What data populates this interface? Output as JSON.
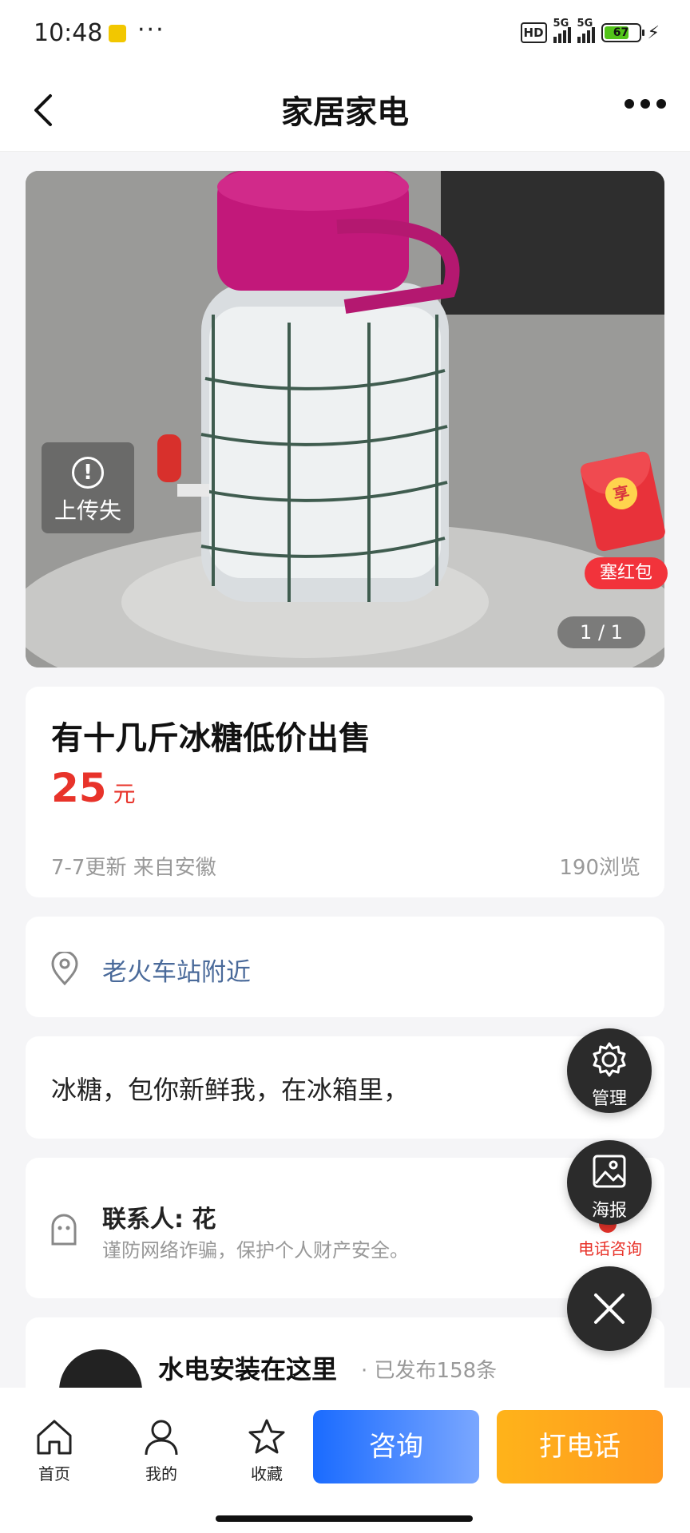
{
  "status": {
    "time": "10:48",
    "dots": "···",
    "hd": "HD",
    "net1": "5G",
    "net2": "5G",
    "battery": "67"
  },
  "header": {
    "title": "家居家电"
  },
  "photo": {
    "upload_status": "上传失",
    "counter": "1 / 1",
    "redpacket_coin": "享",
    "redpacket_label": "塞红包"
  },
  "listing": {
    "title": "有十几斤冰糖低价出售",
    "price": "25",
    "price_unit": "元",
    "updated": "7-7更新 来自安徽",
    "views": "190浏览"
  },
  "location": {
    "text": "老火车站附近"
  },
  "description": {
    "text": "冰糖，包你新鲜我，在冰箱里，"
  },
  "contact": {
    "name": "联系人: 花",
    "warning": "谨防网络诈骗，保护个人财产安全。",
    "phone_consult": "电话咨询"
  },
  "author": {
    "name": "水电安装在这里",
    "count": "· 已发布158条"
  },
  "fabs": {
    "manage": "管理",
    "poster": "海报"
  },
  "bottom": {
    "home": "首页",
    "mine": "我的",
    "favorite": "收藏",
    "consult": "咨询",
    "call": "打电话"
  },
  "colors": {
    "price": "#e8332a",
    "consult": "#1a6bff",
    "call": "#ffa21f"
  }
}
